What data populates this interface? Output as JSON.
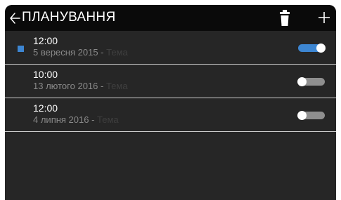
{
  "header": {
    "title": "ПЛАНУВАННЯ",
    "back_icon": "arrow-left-icon",
    "delete_icon": "trash-icon",
    "add_icon": "plus-icon"
  },
  "colors": {
    "accent": "#3d86d2",
    "header_bg": "#0a0a0a",
    "list_bg": "#262626",
    "divider": "#cfcfcf",
    "toggle_off": "#8f8f8f"
  },
  "schedules": [
    {
      "time": "12:00",
      "date": "5 вересня 2015",
      "separator": " - ",
      "topic": "Тема",
      "enabled": true,
      "selected": true
    },
    {
      "time": "10:00",
      "date": "13 лютого 2016",
      "separator": " - ",
      "topic": "Тема",
      "enabled": false,
      "selected": false
    },
    {
      "time": "12:00",
      "date": "4 липня 2016",
      "separator": " - ",
      "topic": "Тема",
      "enabled": false,
      "selected": false
    }
  ]
}
